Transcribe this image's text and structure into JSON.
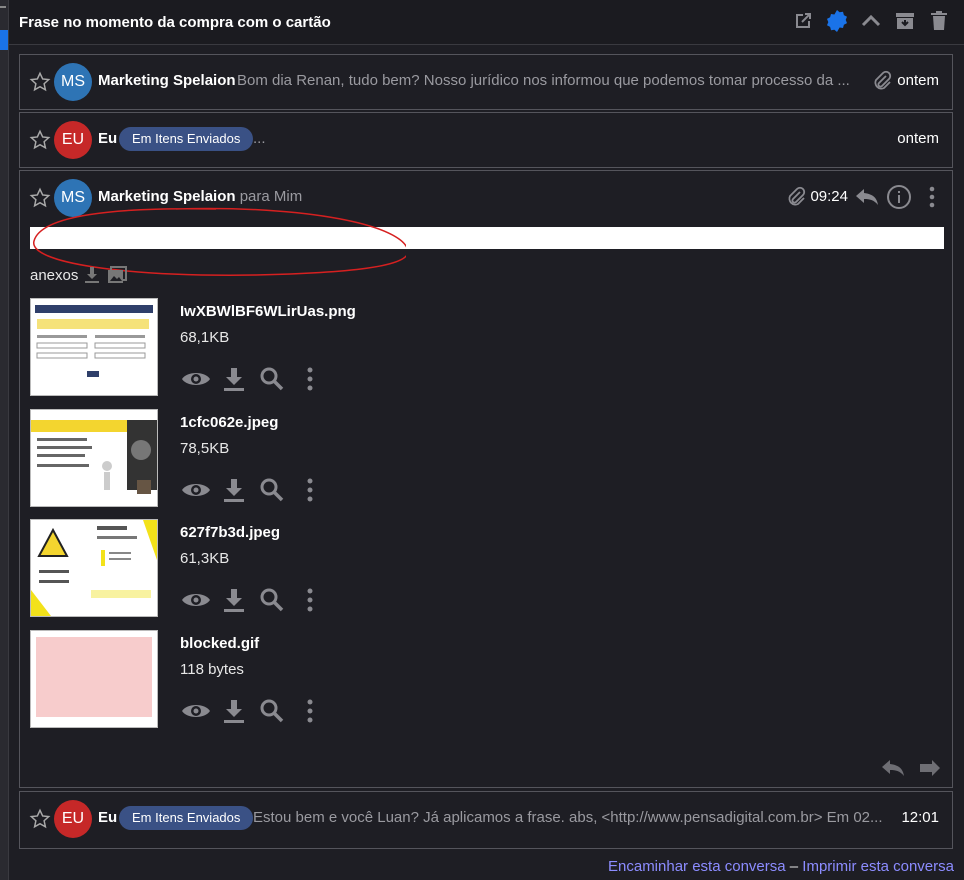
{
  "header": {
    "title": "Frase no momento da compra com o cartão",
    "icons": [
      "open-external-icon",
      "settings-badge-icon",
      "collapse-up-icon",
      "archive-icon",
      "trash-icon"
    ],
    "accent": "#1a73e8"
  },
  "messages": [
    {
      "avatar": "MS",
      "avatar_color": "#2e74b5",
      "sender": "Marketing Spelaion",
      "snippet": "Bom dia Renan, tudo bem? Nosso jurídico nos informou que podemos tomar processo da ...",
      "date": "ontem",
      "has_attachment": true
    },
    {
      "avatar": "EU",
      "avatar_color": "#c62828",
      "sender": "Eu",
      "badge": "Em Itens Enviados",
      "snippet": "...",
      "date": "ontem"
    }
  ],
  "expanded": {
    "avatar": "MS",
    "avatar_color": "#2e74b5",
    "sender": "Marketing Spelaion",
    "to_prefix": "para",
    "to": "Mim",
    "time": "09:24",
    "attachments_label": "anexos",
    "attachments": [
      {
        "name": "IwXBWlBF6WLirUas.png",
        "size": "68,1KB"
      },
      {
        "name": "1cfc062e.jpeg",
        "size": "78,5KB"
      },
      {
        "name": "627f7b3d.jpeg",
        "size": "61,3KB"
      },
      {
        "name": "blocked.gif",
        "size": "118 bytes"
      }
    ]
  },
  "last_message": {
    "avatar": "EU",
    "avatar_color": "#c62828",
    "sender": "Eu",
    "badge": "Em Itens Enviados",
    "snippet": "Estou bem e você Luan? Já aplicamos a frase. abs, <http://www.pensadigital.com.br> Em 02...",
    "date": "12:01"
  },
  "footer": {
    "forward": "Encaminhar esta conversa",
    "separator": "–",
    "print": "Imprimir esta conversa"
  }
}
